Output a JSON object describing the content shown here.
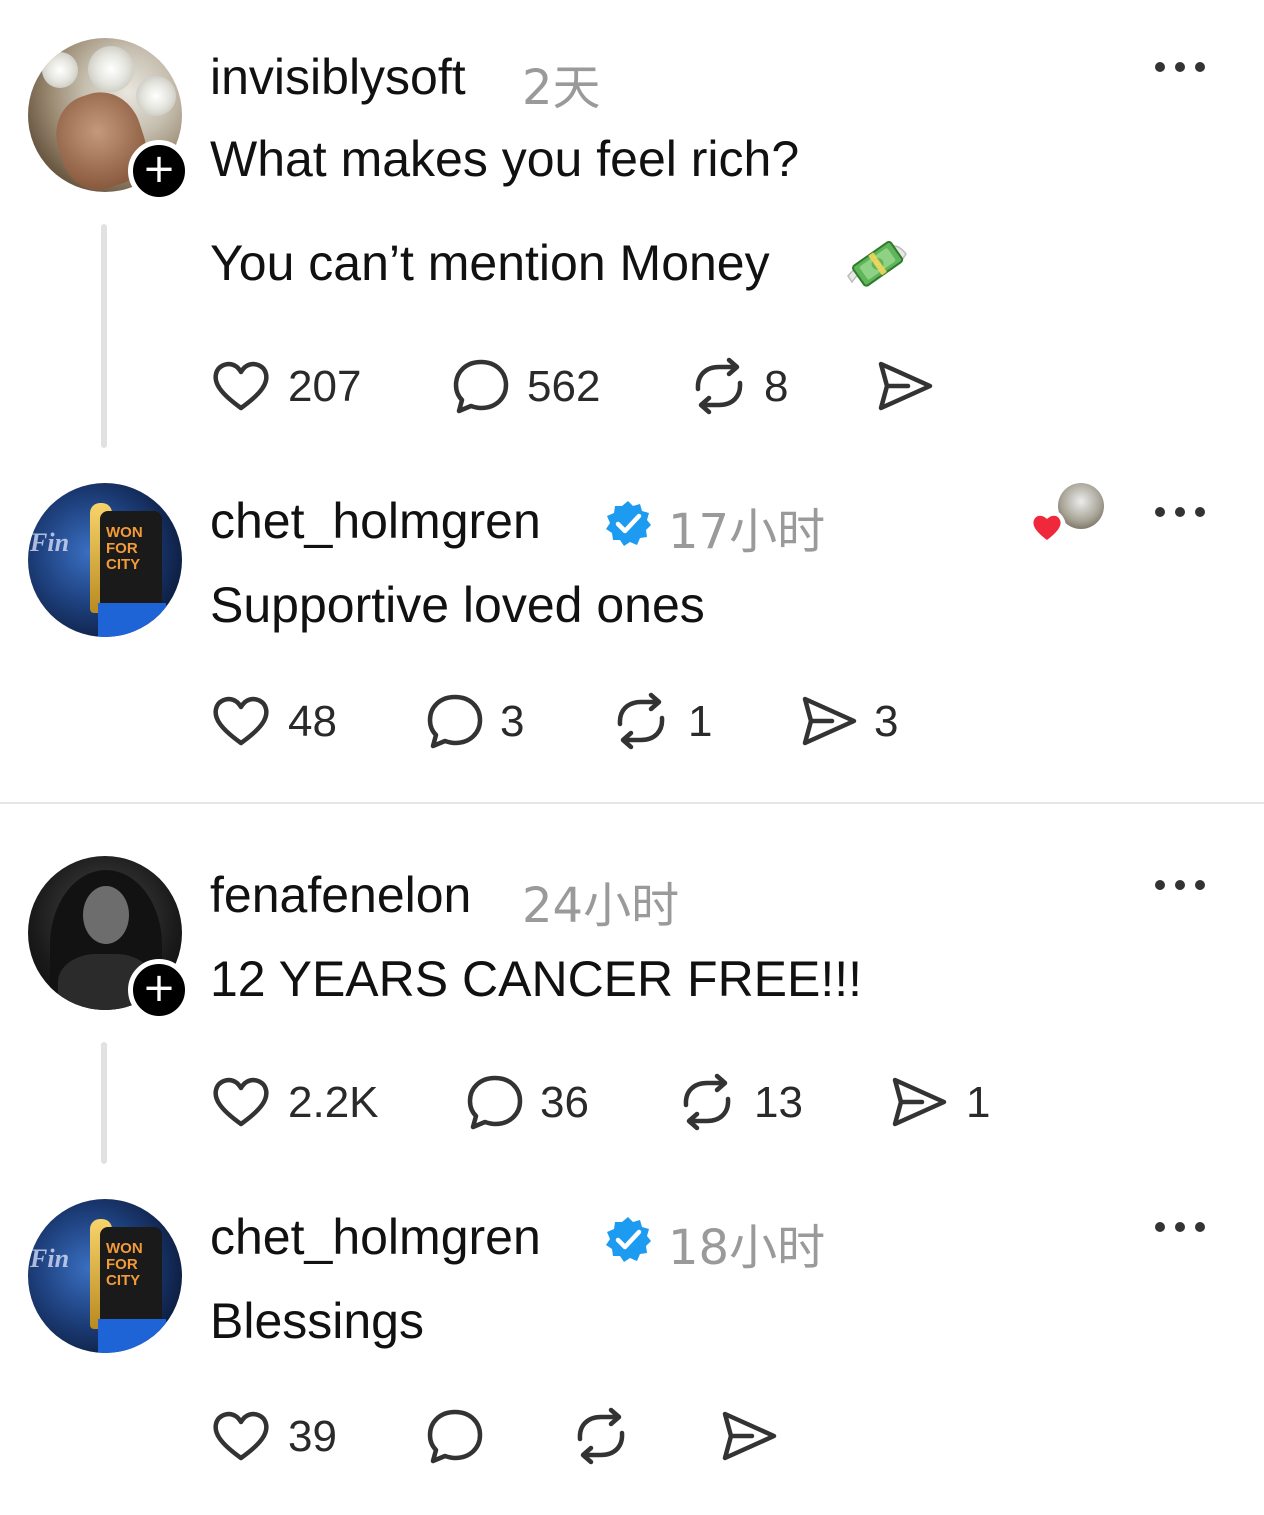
{
  "posts": [
    {
      "username": "invisiblysoft",
      "time": "2天",
      "text_lines": [
        "What makes you feel rich?",
        "You can’t mention Money"
      ],
      "emoji": "money-with-wings",
      "has_follow_badge": true,
      "counts": {
        "likes": "207",
        "replies": "562",
        "reposts": "8",
        "shares": ""
      }
    },
    {
      "username": "chet_holmgren",
      "verified": true,
      "time": "17小时",
      "text_lines": [
        "Supportive loved ones"
      ],
      "liked_by_author": true,
      "counts": {
        "likes": "48",
        "replies": "3",
        "reposts": "1",
        "shares": "3"
      }
    },
    {
      "username": "fenafenelon",
      "time": "24小时",
      "text_lines": [
        "12 YEARS CANCER FREE!!!"
      ],
      "has_follow_badge": true,
      "counts": {
        "likes": "2.2K",
        "replies": "36",
        "reposts": "13",
        "shares": "1"
      }
    },
    {
      "username": "chet_holmgren",
      "verified": true,
      "time": "18小时",
      "text_lines": [
        "Blessings"
      ],
      "counts": {
        "likes": "39",
        "replies": "",
        "reposts": "",
        "shares": ""
      }
    }
  ],
  "icons": {
    "like": "heart-icon",
    "reply": "comment-icon",
    "repost": "repost-icon",
    "share": "send-icon",
    "more": "more-options-icon",
    "verified": "verified-badge-icon"
  },
  "colors": {
    "verified": "#1d9bf0",
    "liked_heart": "#f0283c",
    "muted_text": "#9a9a9a"
  }
}
